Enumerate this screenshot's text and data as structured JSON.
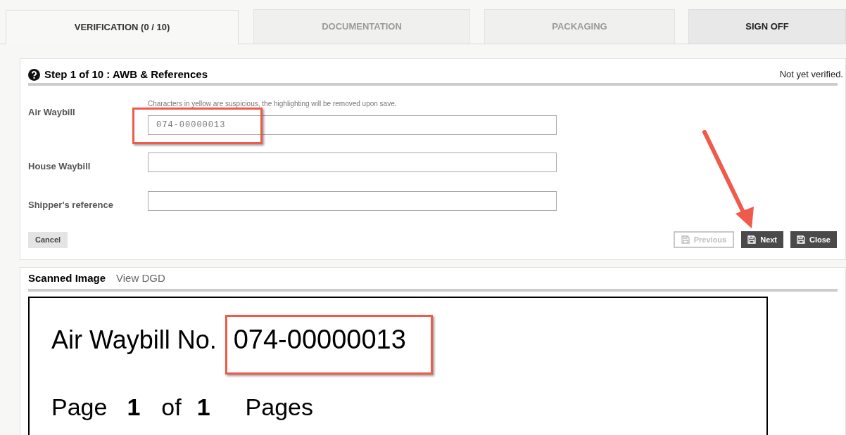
{
  "tabs": [
    {
      "label": "VERIFICATION (0 / 10)",
      "selected": true,
      "disabled": false
    },
    {
      "label": "DOCUMENTATION",
      "selected": false,
      "disabled": true
    },
    {
      "label": "PACKAGING",
      "selected": false,
      "disabled": true
    },
    {
      "label": "SIGN OFF",
      "selected": false,
      "disabled": false
    }
  ],
  "step": {
    "title": "Step 1 of 10 : AWB & References",
    "status": "Not yet verified.",
    "hint": "Characters in yellow are suspicious, the highlighting will be removed upon save.",
    "fields": [
      {
        "label": "Air Waybill",
        "value": "074-00000013"
      },
      {
        "label": "House Waybill"
      },
      {
        "label": "Shipper's reference"
      }
    ],
    "cancel": "Cancel",
    "buttons": [
      {
        "label": "Previous",
        "disabled": true
      },
      {
        "label": "Next",
        "disabled": false
      },
      {
        "label": "Close",
        "disabled": false
      }
    ]
  },
  "viewer": {
    "tabs": [
      {
        "label": "Scanned Image",
        "selected": true
      },
      {
        "label": "View DGD",
        "selected": false
      }
    ],
    "document": {
      "awb_label": "Air Waybill No.",
      "awb_number": "074-00000013",
      "page_line": [
        "Page",
        "1",
        "of",
        "1",
        "Pages"
      ]
    }
  }
}
